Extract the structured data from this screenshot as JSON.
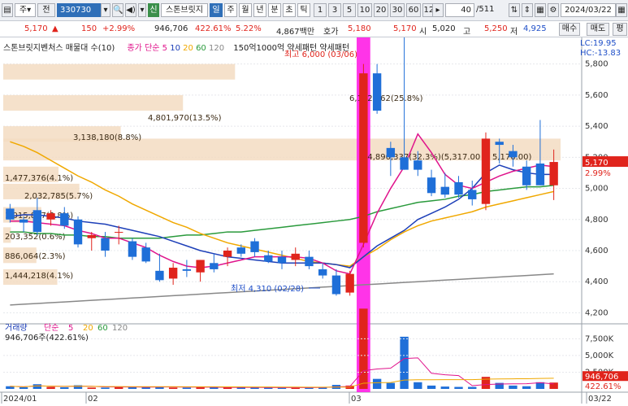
{
  "toolbar": {
    "market_label": "주",
    "prev_label": "전",
    "code_value": "330730",
    "search_icon": "search-icon",
    "credit_badge": "신",
    "stock_name": "스톤브릿지",
    "period_buttons": [
      "일",
      "주",
      "월",
      "년",
      "분",
      "초",
      "틱"
    ],
    "num_buttons": [
      "1",
      "3",
      "5",
      "10",
      "20",
      "30",
      "60",
      "120"
    ],
    "page_value": "40",
    "page_total": "/511",
    "date_value": "2024/03/22"
  },
  "quote": {
    "price": "5,170",
    "arrow": "▲",
    "change": "150",
    "change_pct": "+2.99%",
    "volume": "946,706",
    "vol_ratio": "422.61%",
    "turnover_ratio": "5.22%",
    "trade_value": "4,867백만",
    "ask_label": "호가",
    "ask": "5,180",
    "bid": "5,170",
    "open_label": "시",
    "open": "5,020",
    "high_label": "고",
    "high": "5,250",
    "low_label": "저",
    "low": "4,925",
    "buy_button": "매수",
    "sell_button": "매도",
    "eval_button": "평"
  },
  "legend": {
    "title": "스톤브릿지벤처스 매물대 수(10)",
    "ma_prefix": "종가 단순",
    "ma_periods": [
      "5",
      "10",
      "20",
      "60",
      "120"
    ],
    "ma_colors": [
      "#e0148c",
      "#1d3fb8",
      "#f0a800",
      "#2a9a3c",
      "#888888"
    ],
    "extra": "150억1000억 약세패턴  약세패턴",
    "lc": "LC:19.95",
    "hc": "HC:-13.83"
  },
  "annotations": {
    "high_label": "최고 6,000 (03/06)",
    "low_label": "최저 4,310 (02/28)",
    "vp_labels": [
      "6,192,162(25.8%)",
      "4,801,970(13.5%)",
      "3,138,180(8.8%)",
      "14,890,337(32.3%)(5,317.00 ~ 5,176.00)",
      "1,477,376(4.1%)",
      "2,032,785(5.7%)",
      "1,015,887(2.8%)",
      "203,352(0.6%)",
      "886,064(2.3%)",
      "1,444,218(4.1%)"
    ]
  },
  "price_axis": {
    "ticks": [
      "5,800",
      "5,600",
      "5,400",
      "5,200",
      "5,000",
      "4,800",
      "4,600",
      "4,400",
      "4,200"
    ],
    "current": "5,170",
    "current_pct": "2.99%"
  },
  "volume_panel": {
    "title": "거래량",
    "ma_label": "단순",
    "ma_periods": [
      "5",
      "20",
      "60",
      "120"
    ],
    "value_text": "946,706주(422.61%)",
    "ticks": [
      "7,500K",
      "5,000K",
      "2,500K"
    ],
    "current": "946,706",
    "current_pct": "422.61%"
  },
  "date_axis": {
    "labels": [
      "2024/01",
      "02",
      "03",
      "03/22"
    ]
  },
  "chart_data": {
    "type": "candlestick",
    "candles": [
      {
        "o": 4870,
        "h": 4900,
        "l": 4780,
        "c": 4800
      },
      {
        "o": 4800,
        "h": 4820,
        "l": 4720,
        "c": 4780
      },
      {
        "o": 4860,
        "h": 4940,
        "l": 4700,
        "c": 4720
      },
      {
        "o": 4800,
        "h": 4860,
        "l": 4760,
        "c": 4840
      },
      {
        "o": 4840,
        "h": 4880,
        "l": 4740,
        "c": 4760
      },
      {
        "o": 4800,
        "h": 4820,
        "l": 4620,
        "c": 4640
      },
      {
        "o": 4680,
        "h": 4720,
        "l": 4600,
        "c": 4700
      },
      {
        "o": 4680,
        "h": 4720,
        "l": 4560,
        "c": 4600
      },
      {
        "o": 4720,
        "h": 4760,
        "l": 4640,
        "c": 4720
      },
      {
        "o": 4660,
        "h": 4680,
        "l": 4540,
        "c": 4560
      },
      {
        "o": 4620,
        "h": 4650,
        "l": 4520,
        "c": 4530
      },
      {
        "o": 4470,
        "h": 4580,
        "l": 4400,
        "c": 4410
      },
      {
        "o": 4420,
        "h": 4520,
        "l": 4380,
        "c": 4490
      },
      {
        "o": 4480,
        "h": 4540,
        "l": 4430,
        "c": 4470
      },
      {
        "o": 4460,
        "h": 4540,
        "l": 4400,
        "c": 4540
      },
      {
        "o": 4520,
        "h": 4580,
        "l": 4460,
        "c": 4480
      },
      {
        "o": 4560,
        "h": 4620,
        "l": 4500,
        "c": 4600
      },
      {
        "o": 4620,
        "h": 4640,
        "l": 4560,
        "c": 4580
      },
      {
        "o": 4660,
        "h": 4680,
        "l": 4560,
        "c": 4590
      },
      {
        "o": 4570,
        "h": 4600,
        "l": 4520,
        "c": 4530
      },
      {
        "o": 4560,
        "h": 4600,
        "l": 4480,
        "c": 4520
      },
      {
        "o": 4540,
        "h": 4620,
        "l": 4500,
        "c": 4580
      },
      {
        "o": 4560,
        "h": 4600,
        "l": 4480,
        "c": 4500
      },
      {
        "o": 4480,
        "h": 4520,
        "l": 4420,
        "c": 4440
      },
      {
        "o": 4440,
        "h": 4480,
        "l": 4310,
        "c": 4320
      },
      {
        "o": 4330,
        "h": 4470,
        "l": 4310,
        "c": 4450
      },
      {
        "o": 4650,
        "h": 5800,
        "l": 4620,
        "c": 5740
      },
      {
        "o": 5740,
        "h": 5800,
        "l": 5480,
        "c": 5500
      },
      {
        "o": 5260,
        "h": 5300,
        "l": 5080,
        "c": 5200
      },
      {
        "o": 5200,
        "h": 6000,
        "l": 5120,
        "c": 5120
      },
      {
        "o": 5180,
        "h": 5240,
        "l": 5080,
        "c": 5120
      },
      {
        "o": 5070,
        "h": 5120,
        "l": 4950,
        "c": 4970
      },
      {
        "o": 5010,
        "h": 5100,
        "l": 4940,
        "c": 4960
      },
      {
        "o": 5040,
        "h": 5080,
        "l": 4940,
        "c": 4960
      },
      {
        "o": 4990,
        "h": 5050,
        "l": 4890,
        "c": 4930
      },
      {
        "o": 4900,
        "h": 5360,
        "l": 4860,
        "c": 5320
      },
      {
        "o": 5300,
        "h": 5320,
        "l": 5160,
        "c": 5280
      },
      {
        "o": 5240,
        "h": 5280,
        "l": 5140,
        "c": 5200
      },
      {
        "o": 5140,
        "h": 5180,
        "l": 4990,
        "c": 5020
      },
      {
        "o": 5160,
        "h": 5440,
        "l": 5020,
        "c": 5020
      },
      {
        "o": 5020,
        "h": 5250,
        "l": 4925,
        "c": 5170
      }
    ],
    "volumes": [
      400,
      250,
      700,
      300,
      250,
      550,
      200,
      200,
      250,
      320,
      300,
      350,
      200,
      200,
      300,
      250,
      200,
      200,
      200,
      180,
      200,
      200,
      200,
      300,
      600,
      500,
      12000,
      1500,
      900,
      7800,
      1000,
      500,
      350,
      300,
      300,
      1800,
      900,
      500,
      400,
      1000,
      946.706
    ],
    "volume_unit": "K",
    "volume_max": 9000,
    "y_range": [
      4150,
      5950
    ],
    "ma5": [
      4790,
      4790,
      4780,
      4770,
      4760,
      4730,
      4710,
      4680,
      4680,
      4650,
      4620,
      4570,
      4530,
      4500,
      4490,
      4500,
      4520,
      4540,
      4560,
      4560,
      4560,
      4560,
      4550,
      4520,
      4470,
      4450,
      4640,
      4840,
      5000,
      5140,
      5350,
      5230,
      5090,
      5020,
      5000,
      5040,
      5080,
      5110,
      5130,
      5150,
      5140
    ],
    "ma10": [
      4820,
      4830,
      4830,
      4820,
      4810,
      4790,
      4780,
      4770,
      4750,
      4730,
      4710,
      4690,
      4660,
      4630,
      4600,
      4580,
      4560,
      4550,
      4540,
      4530,
      4520,
      4520,
      4520,
      4520,
      4510,
      4490,
      4560,
      4630,
      4680,
      4730,
      4800,
      4840,
      4880,
      4930,
      5000,
      5100,
      5150,
      5120,
      5100,
      5090,
      5090
    ],
    "ma20": [
      5300,
      5270,
      5230,
      5180,
      5130,
      5080,
      5040,
      4990,
      4950,
      4900,
      4860,
      4820,
      4780,
      4750,
      4710,
      4680,
      4650,
      4630,
      4610,
      4590,
      4570,
      4550,
      4530,
      4520,
      4510,
      4500,
      4560,
      4610,
      4670,
      4720,
      4760,
      4790,
      4810,
      4830,
      4850,
      4880,
      4900,
      4920,
      4940,
      4960,
      4980
    ],
    "ma60": [
      4720,
      4720,
      4710,
      4710,
      4700,
      4700,
      4690,
      4690,
      4680,
      4680,
      4680,
      4680,
      4690,
      4700,
      4700,
      4710,
      4720,
      4720,
      4730,
      4740,
      4750,
      4760,
      4770,
      4780,
      4790,
      4800,
      4820,
      4850,
      4870,
      4890,
      4910,
      4920,
      4930,
      4950,
      4960,
      4980,
      4990,
      5000,
      5010,
      5010,
      5020
    ],
    "ma120": [
      4250,
      4255,
      4260,
      4265,
      4270,
      4275,
      4280,
      4285,
      4290,
      4295,
      4300,
      4305,
      4310,
      4315,
      4320,
      4325,
      4330,
      4335,
      4340,
      4345,
      4350,
      4355,
      4360,
      4365,
      4370,
      4375,
      4380,
      4385,
      4390,
      4395,
      4400,
      4405,
      4410,
      4415,
      4420,
      4425,
      4430,
      4435,
      4440,
      4445,
      4450
    ],
    "volume_profile": [
      {
        "low": 5700,
        "high": 5800,
        "volume": 6192162,
        "pct": 25.8
      },
      {
        "low": 5500,
        "high": 5600,
        "volume": 4801970,
        "pct": 13.5
      },
      {
        "low": 5300,
        "high": 5400,
        "volume": 3138180,
        "pct": 8.8
      },
      {
        "low": 5180,
        "high": 5320,
        "volume": 14890337,
        "pct": 32.3
      },
      {
        "low": 5040,
        "high": 5140,
        "volume": 1477376,
        "pct": 4.1
      },
      {
        "low": 4930,
        "high": 5030,
        "volume": 2032785,
        "pct": 5.7
      },
      {
        "low": 4780,
        "high": 4880,
        "volume": 1015887,
        "pct": 2.8
      },
      {
        "low": 4650,
        "high": 4750,
        "volume": 203352,
        "pct": 0.6
      },
      {
        "low": 4520,
        "high": 4620,
        "volume": 886064,
        "pct": 2.3
      },
      {
        "low": 4380,
        "high": 4480,
        "volume": 1444218,
        "pct": 4.1
      }
    ]
  }
}
